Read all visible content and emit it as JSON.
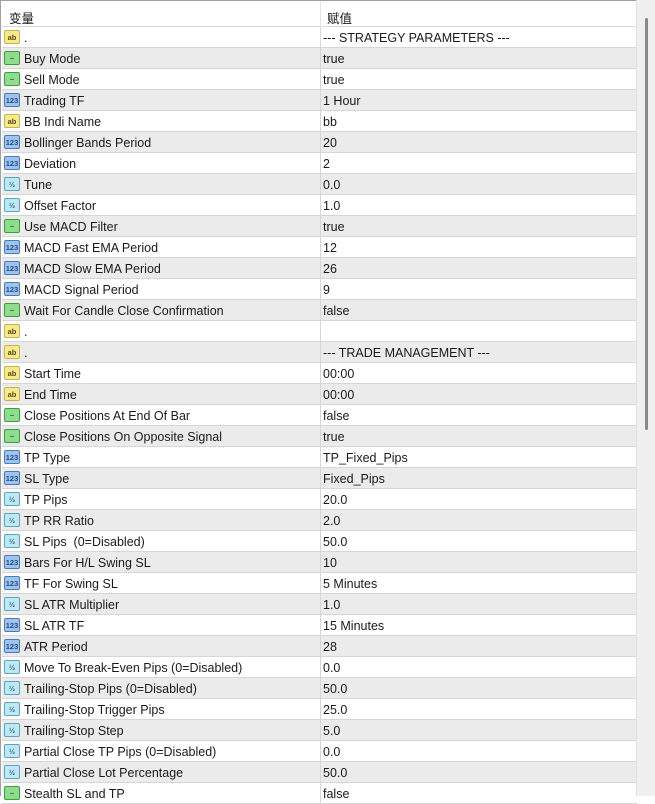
{
  "header": {
    "name_col": "变量",
    "value_col": "赋值"
  },
  "icons": {
    "ab": "ab",
    "bool": "~",
    "int": "123",
    "dbl": "½"
  },
  "rows": [
    {
      "type": "ab",
      "name": ".",
      "value": "--- STRATEGY PARAMETERS ---"
    },
    {
      "type": "bool",
      "name": "Buy Mode",
      "value": "true"
    },
    {
      "type": "bool",
      "name": "Sell Mode",
      "value": "true"
    },
    {
      "type": "int",
      "name": "Trading TF",
      "value": "1 Hour"
    },
    {
      "type": "ab",
      "name": "BB Indi Name",
      "value": "bb"
    },
    {
      "type": "int",
      "name": "Bollinger Bands Period",
      "value": "20"
    },
    {
      "type": "int",
      "name": "Deviation",
      "value": "2"
    },
    {
      "type": "dbl",
      "name": "Tune",
      "value": "0.0"
    },
    {
      "type": "dbl",
      "name": "Offset Factor",
      "value": "1.0"
    },
    {
      "type": "bool",
      "name": "Use MACD Filter",
      "value": "true"
    },
    {
      "type": "int",
      "name": "MACD Fast EMA Period",
      "value": "12"
    },
    {
      "type": "int",
      "name": "MACD Slow EMA Period",
      "value": "26"
    },
    {
      "type": "int",
      "name": "MACD Signal Period",
      "value": "9"
    },
    {
      "type": "bool",
      "name": "Wait For Candle Close Confirmation",
      "value": "false"
    },
    {
      "type": "ab",
      "name": ".",
      "value": ""
    },
    {
      "type": "ab",
      "name": ".",
      "value": "--- TRADE MANAGEMENT ---"
    },
    {
      "type": "ab",
      "name": "Start Time",
      "value": "00:00"
    },
    {
      "type": "ab",
      "name": "End Time",
      "value": "00:00"
    },
    {
      "type": "bool",
      "name": "Close Positions At End Of Bar",
      "value": "false"
    },
    {
      "type": "bool",
      "name": "Close Positions On Opposite Signal",
      "value": "true"
    },
    {
      "type": "int",
      "name": "TP Type",
      "value": "TP_Fixed_Pips"
    },
    {
      "type": "int",
      "name": "SL Type",
      "value": "Fixed_Pips"
    },
    {
      "type": "dbl",
      "name": "TP Pips",
      "value": "20.0"
    },
    {
      "type": "dbl",
      "name": "TP RR Ratio",
      "value": "2.0"
    },
    {
      "type": "dbl",
      "name": "SL Pips  (0=Disabled)",
      "value": "50.0"
    },
    {
      "type": "int",
      "name": "Bars For H/L Swing SL",
      "value": "10"
    },
    {
      "type": "int",
      "name": "TF For Swing SL",
      "value": "5 Minutes"
    },
    {
      "type": "dbl",
      "name": "SL ATR Multiplier",
      "value": "1.0"
    },
    {
      "type": "int",
      "name": "SL ATR TF",
      "value": "15 Minutes"
    },
    {
      "type": "int",
      "name": "ATR Period",
      "value": "28"
    },
    {
      "type": "dbl",
      "name": "Move To Break-Even Pips (0=Disabled)",
      "value": "0.0"
    },
    {
      "type": "dbl",
      "name": "Trailing-Stop Pips (0=Disabled)",
      "value": "50.0"
    },
    {
      "type": "dbl",
      "name": "Trailing-Stop Trigger Pips",
      "value": "25.0"
    },
    {
      "type": "dbl",
      "name": "Trailing-Stop Step",
      "value": "5.0"
    },
    {
      "type": "dbl",
      "name": "Partial Close TP Pips (0=Disabled)",
      "value": "0.0"
    },
    {
      "type": "dbl",
      "name": "Partial Close Lot Percentage",
      "value": "50.0"
    },
    {
      "type": "bool",
      "name": "Stealth SL and TP",
      "value": "false"
    }
  ]
}
